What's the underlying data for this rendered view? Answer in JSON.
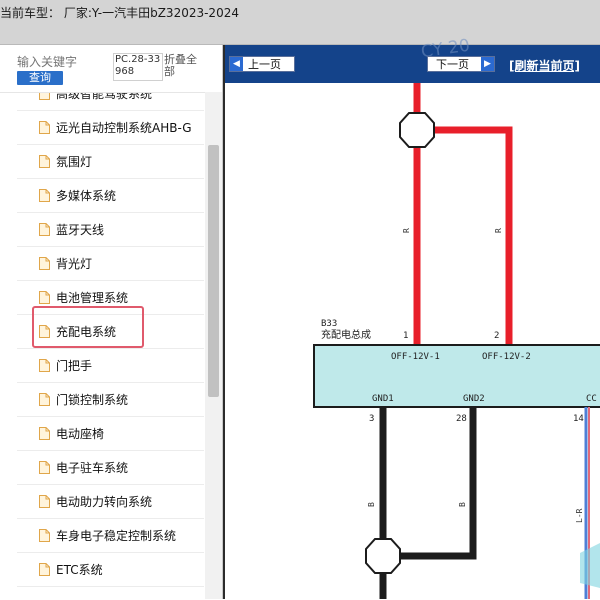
{
  "window": {
    "title": "当前车型： 厂家:Y-一汽丰田bZ32023-2024"
  },
  "sidebar": {
    "search": {
      "placeholder": "输入关键字",
      "button": "查询"
    },
    "pc_code": "PC.28-33968",
    "fold_all": "折叠全部",
    "items": [
      {
        "label": "高级智能驾驶系统"
      },
      {
        "label": "远光自动控制系统AHB-G"
      },
      {
        "label": "氛围灯"
      },
      {
        "label": "多媒体系统"
      },
      {
        "label": "蓝牙天线"
      },
      {
        "label": "背光灯"
      },
      {
        "label": "电池管理系统"
      },
      {
        "label": "充配电系统"
      },
      {
        "label": "门把手"
      },
      {
        "label": "门锁控制系统"
      },
      {
        "label": "电动座椅"
      },
      {
        "label": "电子驻车系统"
      },
      {
        "label": "电动助力转向系统"
      },
      {
        "label": "车身电子稳定控制系统"
      },
      {
        "label": "ETC系统"
      }
    ],
    "selected_index": 7
  },
  "toolbar": {
    "prev": "上一页",
    "next": "下一页",
    "refresh": "[刷新当前页]",
    "watermark": "CY 20"
  },
  "diagram": {
    "connector_id": "B33",
    "component_name": "充配电总成",
    "pins": [
      {
        "number": "1",
        "signal": "OFF-12V-1"
      },
      {
        "number": "2",
        "signal": "OFF-12V-2"
      },
      {
        "number": "3",
        "signal": "GND1"
      },
      {
        "number": "28",
        "signal": "GND2"
      },
      {
        "number": "14",
        "signal": "CC"
      }
    ],
    "wire_colors": {
      "pin1": "R",
      "pin2": "R",
      "pin3": "B",
      "pin28": "B",
      "pin14": "L-R"
    },
    "colors": {
      "red_wire": "#e81f2a",
      "black_wire": "#1c1c1c",
      "component_fill": "#bfe9ea",
      "navbar": "#14438a",
      "highlight": "#e05a6c"
    }
  }
}
